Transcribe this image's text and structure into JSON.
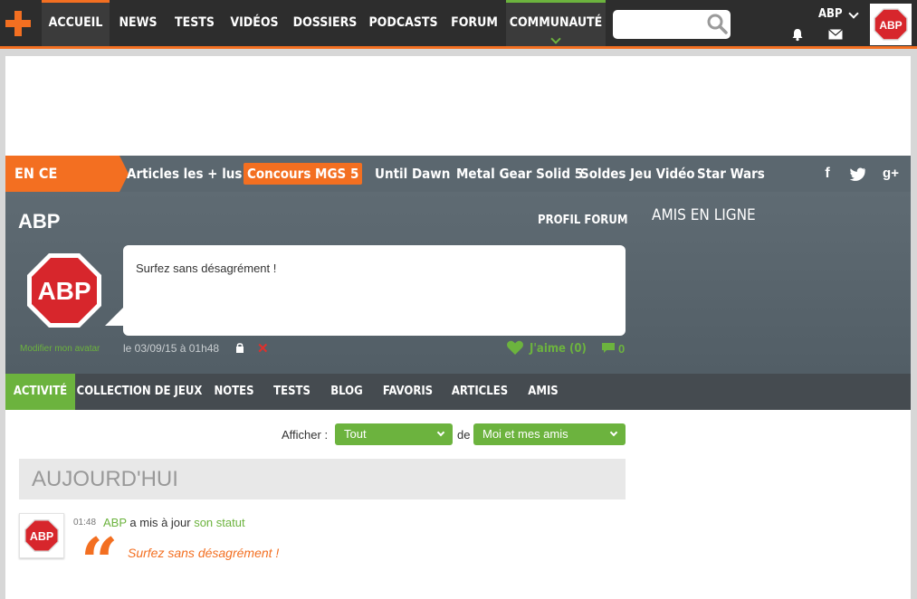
{
  "nav": {
    "items": [
      "ACCUEIL",
      "NEWS",
      "TESTS",
      "VIDÉOS",
      "DOSSIERS",
      "PODCASTS",
      "FORUM",
      "COMMUNAUTÉ"
    ],
    "user_name": "ABP"
  },
  "trending": {
    "label": "EN CE MOMENT",
    "items": [
      "Articles les + lus",
      "Concours MGS 5",
      "Until Dawn",
      "Metal Gear Solid 5",
      "Soldes Jeu Vidéo",
      "Star Wars"
    ],
    "social": [
      "f",
      "t",
      "g+"
    ]
  },
  "profile": {
    "name": "ABP",
    "forum_link": "PROFIL FORUM",
    "friends_online": "AMIS EN LIGNE",
    "status": "Surfez sans désagrément !",
    "edit_avatar": "Modifier mon avatar",
    "date": "le 03/09/15 à 01h48",
    "like": "J'aime (0)",
    "comments": "0"
  },
  "tabs": [
    "ACTIVITÉ",
    "COLLECTION DE JEUX",
    "NOTES",
    "TESTS",
    "BLOG",
    "FAVORIS",
    "ARTICLES",
    "AMIS"
  ],
  "filter": {
    "label": "Afficher :",
    "show": "Tout",
    "de": "de",
    "scope": "Moi et mes amis"
  },
  "feed": {
    "section": "AUJOURD'HUI",
    "time": "01:48",
    "user": "ABP",
    "action": " a mis à jour ",
    "target": "son statut",
    "quote": "Surfez sans désagrément !"
  },
  "colors": {
    "orange": "#f36f21",
    "green": "#6cb33e",
    "dark": "#2d2d2d",
    "slate": "#5b676f",
    "abp_red": "#d7262c"
  },
  "icons": [
    "plus-logo-icon",
    "search-icon",
    "bell-icon",
    "mail-icon",
    "lock-icon",
    "delete-icon",
    "heart-icon",
    "comment-icon",
    "quote-icon"
  ]
}
